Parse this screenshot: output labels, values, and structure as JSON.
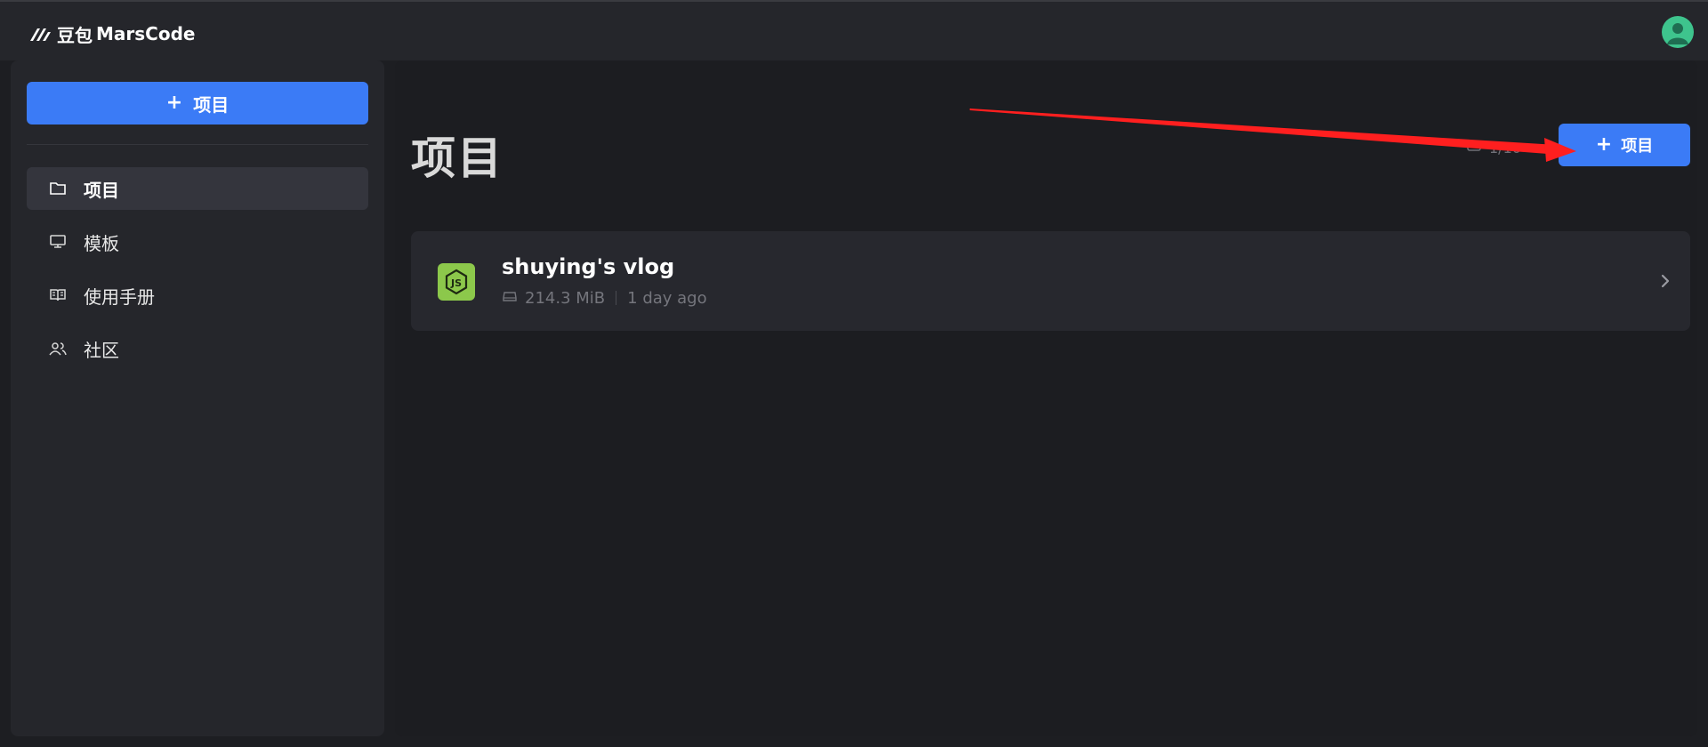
{
  "header": {
    "logo_cn": "豆包",
    "logo_en": "MarsCode",
    "avatar_icon": "user-avatar-icon",
    "avatar_color": "#3ec48d"
  },
  "sidebar": {
    "new_button": {
      "icon": "plus-icon",
      "label": "项目"
    },
    "items": [
      {
        "icon": "folder-icon",
        "label": "项目",
        "active": true
      },
      {
        "icon": "monitor-icon",
        "label": "模板",
        "active": false
      },
      {
        "icon": "book-icon",
        "label": "使用手册",
        "active": false
      },
      {
        "icon": "users-icon",
        "label": "社区",
        "active": false
      }
    ]
  },
  "main": {
    "title": "项目",
    "counter": {
      "icon": "storage-icon",
      "text": "1/10"
    },
    "new_button": {
      "icon": "plus-icon",
      "label": "项目"
    },
    "projects": [
      {
        "name": "shuying's vlog",
        "icon": "nodejs-icon",
        "size": "214.3 MiB",
        "updated": "1 day ago"
      }
    ]
  },
  "colors": {
    "accent": "#3b7bf6",
    "background": "#1d1e22",
    "panel": "#25262b",
    "node_green": "#8cc84b",
    "annotation_red": "#ff1f1f"
  }
}
